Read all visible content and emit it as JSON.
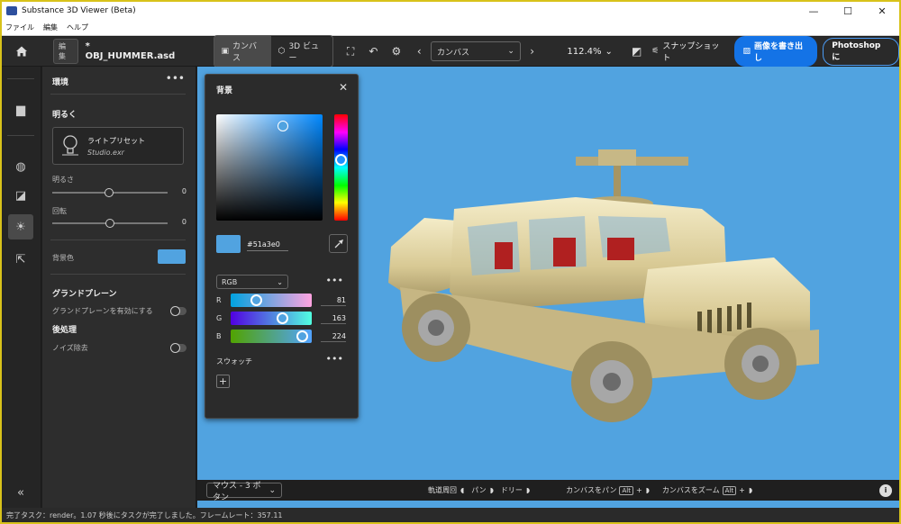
{
  "window": {
    "title": "Substance 3D Viewer (Beta)",
    "minimize": "—",
    "maximize": "☐",
    "close": "✕"
  },
  "menu": [
    "ファイル",
    "編集",
    "ヘルプ"
  ],
  "toolbar": {
    "edit_tag": "編集",
    "document_name": "* OBJ_HUMMER.asd",
    "tab_canvas": "カンバス",
    "tab_3d": "3D ビュー",
    "camera_select": "カンバス",
    "zoom": "112.4%",
    "snapshot": "スナップショット",
    "export_image": "画像を書き出し",
    "photoshop": "Photoshop に"
  },
  "environment": {
    "title": "環境",
    "brightness_section": "明るく",
    "preset_name": "ライトプリセット",
    "preset_file": "Studio.exr",
    "brightness_label": "明るさ",
    "brightness_value": "0",
    "rotation_label": "回転",
    "rotation_value": "0",
    "bg_color_label": "背景色",
    "ground_section": "グランドプレーン",
    "ground_enable": "グランドプレーンを有効にする",
    "post_section": "後処理",
    "denoise": "ノイズ除去"
  },
  "color_popup": {
    "title": "背景",
    "hex": "#51a3e0",
    "mode": "RGB",
    "r_label": "R",
    "r_value": "81",
    "g_label": "G",
    "g_value": "163",
    "b_label": "B",
    "b_value": "224",
    "swatches": "スウォッチ",
    "add": "+",
    "more": "•••"
  },
  "bottom": {
    "mouse_mode": "マウス - 3 ボタン",
    "orbit": "軌道周回",
    "pan": "パン",
    "dolly": "ドリー",
    "canvas_pan": "カンバスをパン",
    "canvas_zoom": "カンバスをズーム",
    "alt_key": "Alt",
    "plus": "+"
  },
  "status": "完了タスク：render。1.07 秒後にタスクが完了しました。フレームレート：357.11",
  "colors": {
    "accent": "#1473e6",
    "background_color": "#51a3e0",
    "frame": "#d8c21a"
  }
}
